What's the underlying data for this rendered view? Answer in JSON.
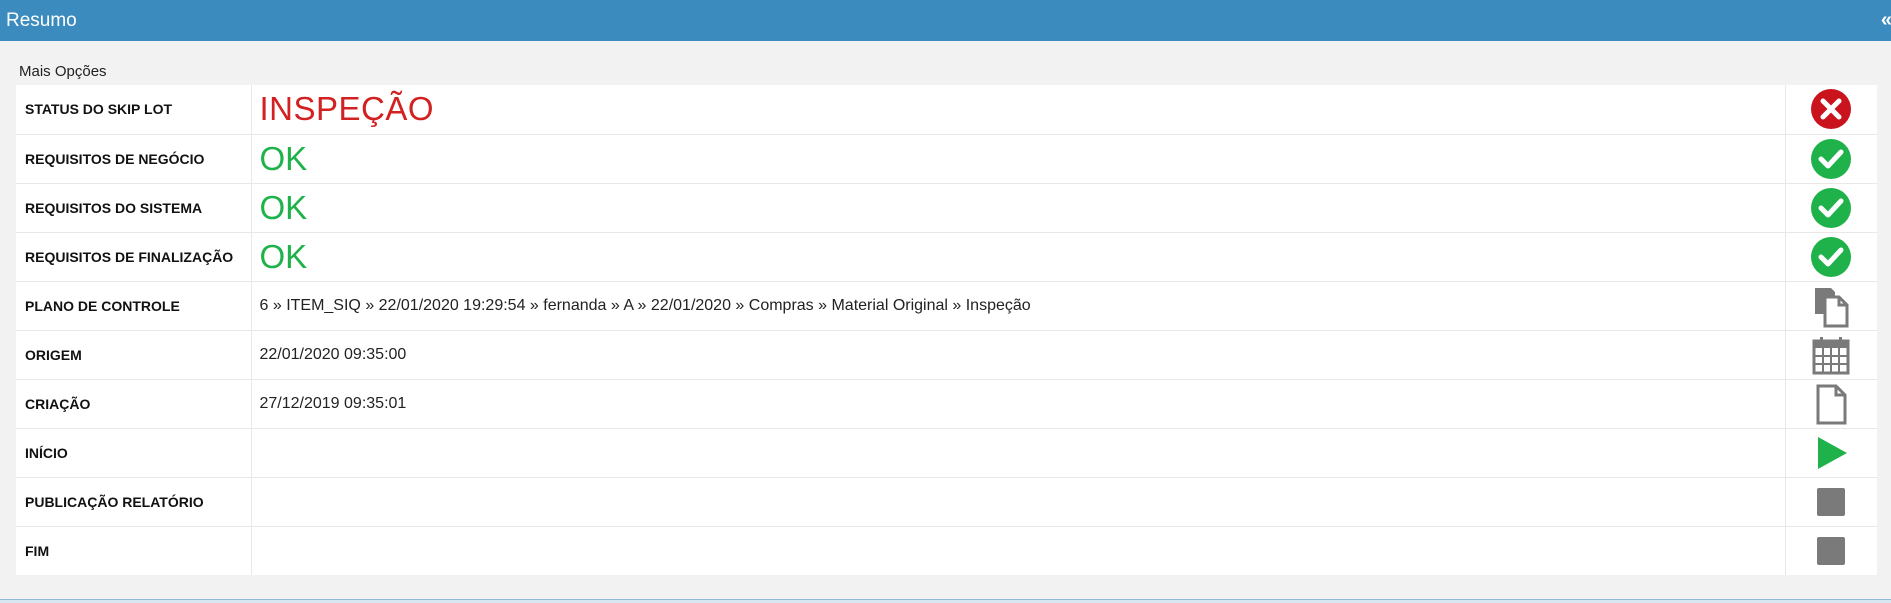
{
  "header": {
    "title": "Resumo",
    "collapse": "«"
  },
  "more_options": "Mais Opções",
  "rows": [
    {
      "label": "STATUS DO SKIP LOT",
      "value": "INSPEÇÃO",
      "style": "red",
      "icon": "error-x-icon"
    },
    {
      "label": "REQUISITOS DE NEGÓCIO",
      "value": "OK",
      "style": "green",
      "icon": "check-icon"
    },
    {
      "label": "REQUISITOS DO SISTEMA",
      "value": "OK",
      "style": "green",
      "icon": "check-icon"
    },
    {
      "label": "REQUISITOS DE FINALIZAÇÃO",
      "value": "OK",
      "style": "green",
      "icon": "check-icon"
    },
    {
      "label": "PLANO DE CONTROLE",
      "value": "6 » ITEM_SIQ » 22/01/2020 19:29:54 » fernanda » A » 22/01/2020 » Compras » Material Original » Inspeção",
      "style": "normal",
      "icon": "copy-documents-icon"
    },
    {
      "label": "ORIGEM",
      "value": "22/01/2020 09:35:00",
      "style": "normal",
      "icon": "calendar-icon"
    },
    {
      "label": "CRIAÇÃO",
      "value": "27/12/2019 09:35:01",
      "style": "normal",
      "icon": "document-icon"
    },
    {
      "label": "INÍCIO",
      "value": "",
      "style": "normal",
      "icon": "play-icon"
    },
    {
      "label": "PUBLICAÇÃO RELATÓRIO",
      "value": "",
      "style": "normal",
      "icon": "stop-icon"
    },
    {
      "label": "FIM",
      "value": "",
      "style": "normal",
      "icon": "stop-icon"
    }
  ],
  "colors": {
    "header_bg": "#3b8bbf",
    "status_red": "#d32020",
    "ok_green": "#1fb24a",
    "icon_gray": "#7a7a7a"
  }
}
